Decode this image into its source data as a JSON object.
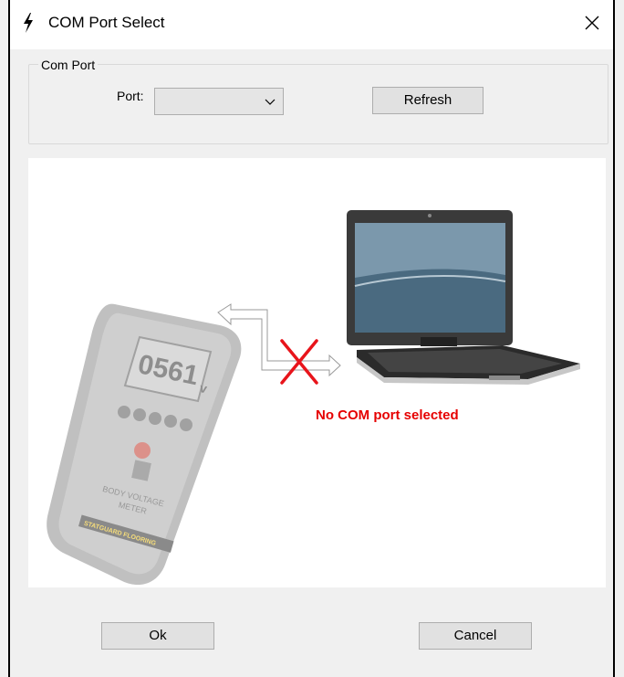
{
  "window": {
    "title": "COM Port Select"
  },
  "icons": {
    "app": "lightning-bolt-icon",
    "close": "close-icon",
    "dropdown": "chevron-down-icon"
  },
  "com_port": {
    "group_label": "Com Port",
    "port_label": "Port:",
    "port_value": "",
    "refresh_label": "Refresh"
  },
  "diagram": {
    "meter": {
      "display_value": "0561",
      "display_unit": "v",
      "panel_text_1": "BODY VOLTAGE",
      "panel_text_2": "METER",
      "brand": "STATGUARD FLOORING"
    },
    "status_message": "No COM port selected"
  },
  "buttons": {
    "ok_label": "Ok",
    "cancel_label": "Cancel"
  },
  "colors": {
    "status_error": "#e60000",
    "x_mark": "#e8141b"
  }
}
